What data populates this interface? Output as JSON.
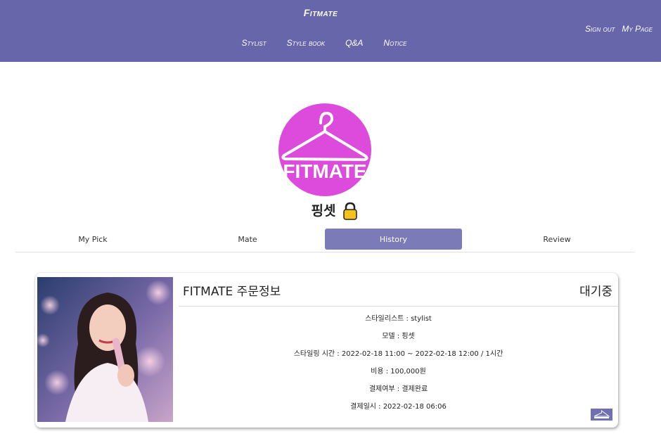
{
  "header": {
    "brand": "Fitmate",
    "nav": [
      "Stylist",
      "Style book",
      "Q&A",
      "Notice"
    ],
    "user_links": [
      "Sign out",
      "My Page"
    ]
  },
  "profile": {
    "name": "핑셋",
    "avatar_text": "FITMATE"
  },
  "tabs": [
    "My Pick",
    "Mate",
    "History",
    "Review"
  ],
  "active_tab": "History",
  "order": {
    "title": "FITMATE 주문정보",
    "status": "대기중",
    "details": [
      "스타일리스트 : stylist",
      "모델 : 핑셋",
      "스타일링 시간 : 2022-02-18 11:00 ~ 2022-02-18 12:00 / 1시간",
      "비용 : 100,000원",
      "결제여부 : 결제완료",
      "결제일시 : 2022-02-18 06:06"
    ]
  },
  "colors": {
    "header_bg": "#6766ab",
    "active_tab": "#7b7bb8",
    "avatar_bg": "#dd4bdc"
  },
  "icons": [
    "hanger-icon",
    "lock-icon",
    "fitmate-mini-logo"
  ]
}
